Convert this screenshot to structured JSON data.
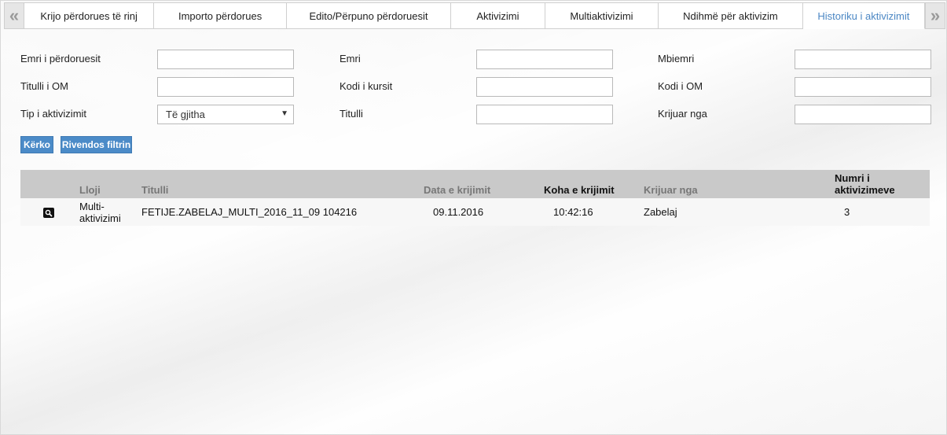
{
  "tabs": {
    "prev_icon": "double-chevron-left-icon",
    "next_icon": "double-chevron-right-icon",
    "items": [
      {
        "label": "Krijo përdorues të rinj"
      },
      {
        "label": "Importo përdorues"
      },
      {
        "label": "Edito/Përpuno përdoruesit"
      },
      {
        "label": "Aktivizimi"
      },
      {
        "label": "Multiaktivizimi"
      },
      {
        "label": "Ndihmë për aktivizim"
      },
      {
        "label": "Historiku i aktivizimit",
        "active": true
      }
    ]
  },
  "form": {
    "username_label": "Emri i përdoruesit",
    "firstname_label": "Emri",
    "lastname_label": "Mbiemri",
    "om_title_label": "Titulli i OM",
    "course_code_label": "Kodi i kursit",
    "om_code_label": "Kodi i OM",
    "activation_type_label": "Tip i aktivizimit",
    "activation_type_value": "Të gjitha",
    "title_label": "Titulli",
    "created_by_label": "Krijuar nga"
  },
  "buttons": {
    "search": "Kërko",
    "reset": "Rivendos filtrin"
  },
  "table": {
    "headers": {
      "type": "Lloji",
      "title": "Titulli",
      "created_date": "Data e krijimit",
      "created_time": "Koha e krijimit",
      "created_by": "Krijuar nga",
      "count_line1": "Numri i",
      "count_line2": "aktivizimeve"
    },
    "rows": [
      {
        "type_line1": "Multi-",
        "type_line2": "aktivizimi",
        "title": "FETIJE.ZABELAJ_MULTI_2016_11_09 104216",
        "created_date": "09.11.2016",
        "created_time": "10:42:16",
        "created_by": "Zabelaj",
        "count": "3"
      }
    ]
  },
  "colors": {
    "accent": "#4b8bc8",
    "active_tab": "#4b87c4",
    "table_header": "#c9c9c9"
  }
}
